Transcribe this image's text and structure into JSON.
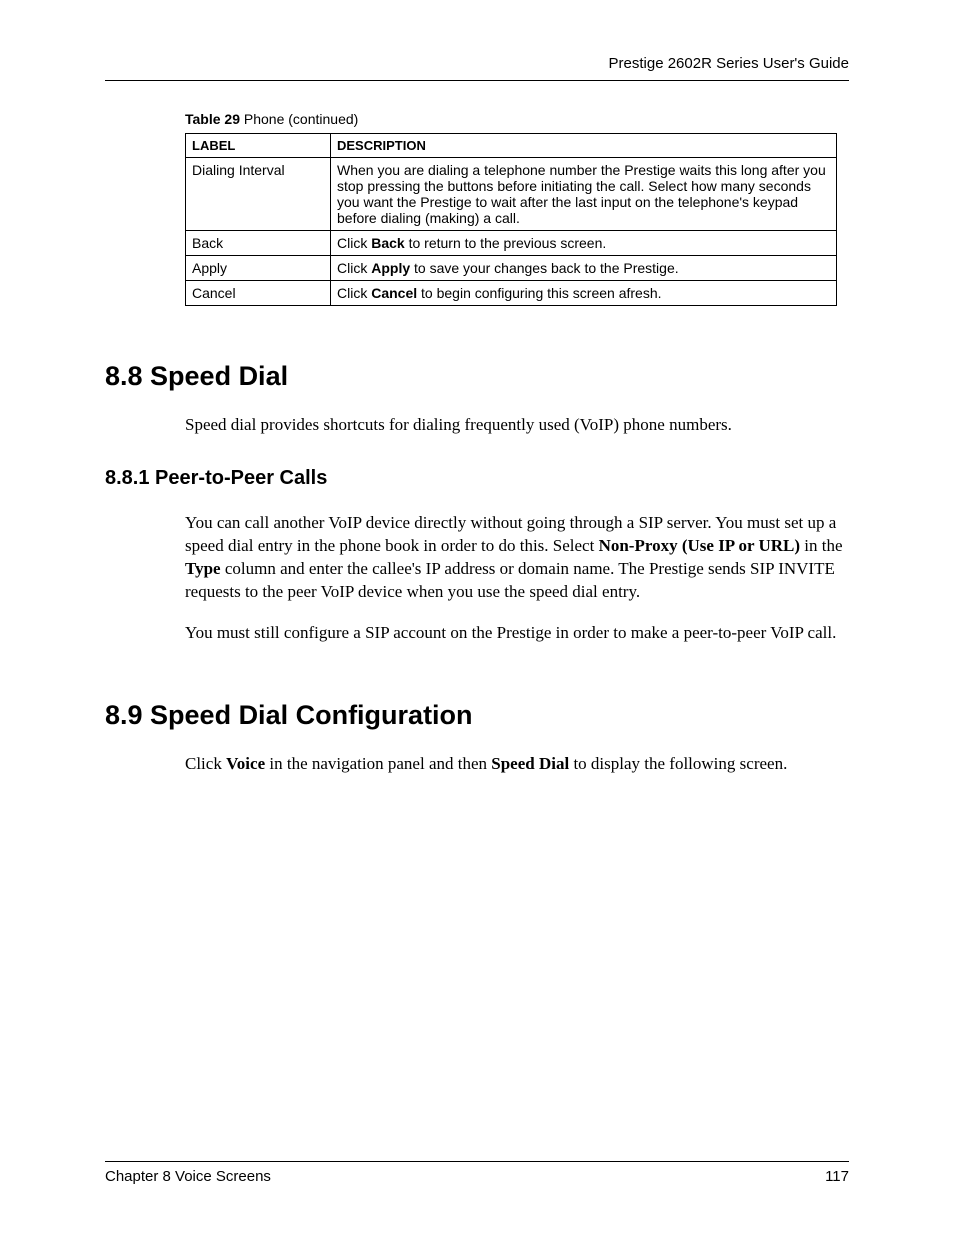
{
  "header": {
    "guide_title": "Prestige 2602R Series User's Guide"
  },
  "table": {
    "caption_bold": "Table 29",
    "caption_rest": "   Phone (continued)",
    "headers": {
      "label": "LABEL",
      "description": "DESCRIPTION"
    },
    "rows": {
      "dialing_interval": {
        "label": "Dialing Interval",
        "desc": "When you are dialing a telephone number the Prestige waits this long after you stop pressing the buttons before initiating the call. Select how many seconds you want the Prestige to wait after the last input on the telephone's keypad before dialing (making) a call."
      },
      "back": {
        "label": "Back",
        "desc_pre": "Click ",
        "desc_bold": "Back",
        "desc_post": " to return to the previous screen."
      },
      "apply": {
        "label": "Apply",
        "desc_pre": "Click ",
        "desc_bold": "Apply",
        "desc_post": " to save your changes back to the Prestige."
      },
      "cancel": {
        "label": "Cancel",
        "desc_pre": "Click ",
        "desc_bold": "Cancel",
        "desc_post": " to begin configuring this screen afresh."
      }
    }
  },
  "section_8_8": {
    "heading": "8.8  Speed Dial",
    "para": "Speed dial provides shortcuts for dialing frequently used (VoIP) phone numbers."
  },
  "section_8_8_1": {
    "heading": "8.8.1  Peer-to-Peer Calls",
    "para1_pre": "You can call another VoIP device directly without going through a SIP server. You must set up a speed dial entry in the phone book in order to do this. Select ",
    "para1_bold1": "Non-Proxy (Use IP or URL)",
    "para1_mid": " in the ",
    "para1_bold2": "Type",
    "para1_post": " column and enter the callee's IP address or domain name. The Prestige sends SIP INVITE requests to the peer VoIP device when you use the speed dial entry.",
    "para2": "You must still configure a SIP account on the Prestige in order to make a peer-to-peer VoIP call."
  },
  "section_8_9": {
    "heading": "8.9  Speed Dial Configuration",
    "para_pre": "Click ",
    "para_bold1": "Voice",
    "para_mid": " in the navigation panel and then ",
    "para_bold2": "Speed Dial",
    "para_post": " to display the following screen."
  },
  "footer": {
    "chapter": "Chapter 8 Voice Screens",
    "page": "117"
  }
}
